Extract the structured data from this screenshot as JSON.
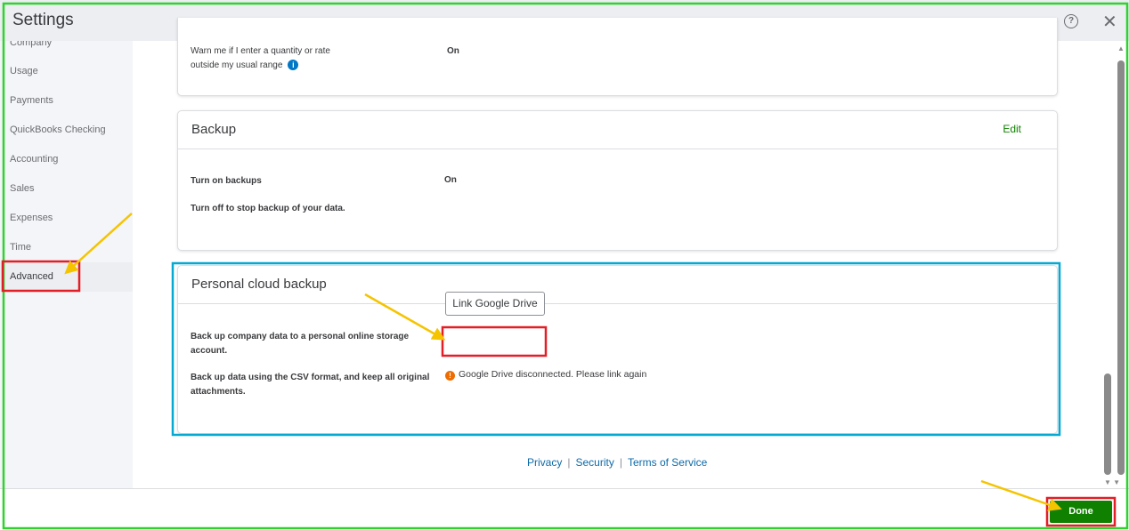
{
  "window": {
    "title": "Settings",
    "help_icon": "help-circle-icon",
    "close_icon": "close-icon"
  },
  "sidebar": {
    "items": [
      {
        "label": "Company"
      },
      {
        "label": "Usage"
      },
      {
        "label": "Payments"
      },
      {
        "label": "QuickBooks Checking"
      },
      {
        "label": "Accounting"
      },
      {
        "label": "Sales"
      },
      {
        "label": "Expenses"
      },
      {
        "label": "Time"
      },
      {
        "label": "Advanced",
        "active": true
      }
    ]
  },
  "warn_card": {
    "line1": "Warn me if I enter a quantity or rate",
    "line2": "outside my usual range",
    "value": "On"
  },
  "backup": {
    "title": "Backup",
    "edit": "Edit",
    "setting_label": "Turn on backups",
    "setting_value": "On",
    "note": "Turn off to stop backup of your data."
  },
  "cloud": {
    "title": "Personal cloud backup",
    "desc1_l1": "Back up company data to a personal online storage",
    "desc1_l2": "account.",
    "desc2_l1": "Back up data using the CSV format, and keep all original",
    "desc2_l2": "attachments.",
    "button": "Link Google Drive",
    "status": "Google Drive disconnected. Please link again"
  },
  "footer": {
    "links": [
      "Privacy",
      "Security",
      "Terms of Service"
    ],
    "done": "Done"
  },
  "colors": {
    "accent_green": "#108000",
    "link_blue": "#0d6aa8",
    "warning": "#ef6c00"
  }
}
